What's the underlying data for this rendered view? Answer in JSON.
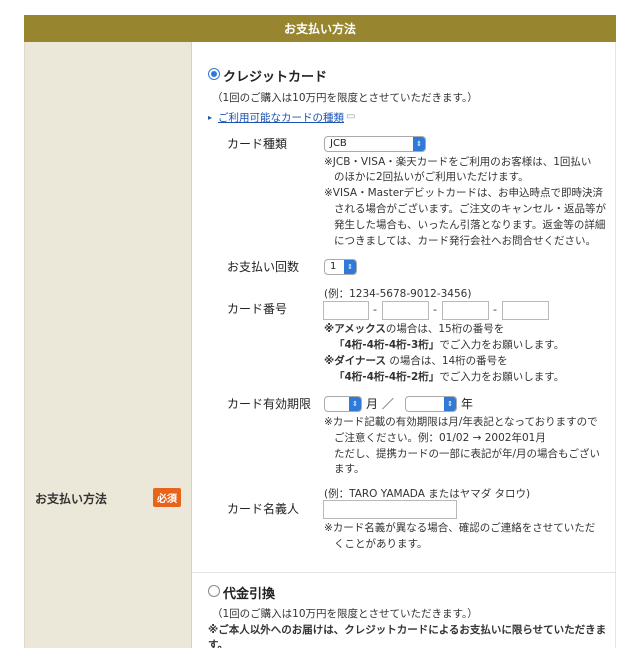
{
  "section": {
    "title": "お支払い方法"
  },
  "left": {
    "label": "お支払い方法",
    "required": "必須"
  },
  "credit": {
    "title": "クレジットカード",
    "limit_note": "（1回のご購入は10万円を限度とさせていただきます。）",
    "cards_link": "ご利用可能なカードの種類",
    "card_type": {
      "label": "カード種類",
      "selected": "JCB",
      "notes": [
        "※JCB・VISA・楽天カードをご利用のお客様は、1回払い",
        "のほかに2回払いがご利用いただけます。",
        "※VISA・Masterデビットカードは、お申込時点で即時決済",
        "される場合がございます。ご注文のキャンセル・返品等が",
        "発生した場合も、いったん引落となります。返金等の詳細",
        "につきましては、カード発行会社へお問合せください。"
      ]
    },
    "installments": {
      "label": "お支払い回数",
      "selected": "1"
    },
    "card_number": {
      "label": "カード番号",
      "example": "(例：1234-5678-9012-3456)",
      "sep": "-",
      "amex_note_prefix": "※アメックス",
      "amex_note_suffix": "の場合は、15桁の番号を",
      "amex_format": "「4桁-4桁-4桁-3桁」",
      "amex_format_suffix": "でご入力をお願いします。",
      "diners_note_prefix": "※ダイナース",
      "diners_note_suffix": " の場合は、14桁の番号を",
      "diners_format": "「4桁-4桁-4桁-2桁」",
      "diners_format_suffix": "でご入力をお願いします。"
    },
    "expiry": {
      "label": "カード有効期限",
      "month_label": "月 ／",
      "year_label": "年",
      "notes": [
        "※カード記載の有効期限は月/年表記となっておりますので",
        "ご注意ください。例：01/02 → 2002年01月",
        "ただし、提携カードの一部に表記が年/月の場合もござい",
        "ます。"
      ]
    },
    "holder": {
      "label": "カード名義人",
      "example": "(例：TARO YAMADA またはヤマダ タロウ)",
      "notes": [
        "※カード名義が異なる場合、確認のご連絡をさせていただ",
        "くことがあります。"
      ]
    }
  },
  "cod": {
    "title": "代金引換",
    "limit_note": "（1回のご購入は10万円を限度とさせていただきます。）",
    "warning": "※ご本人以外へのお届けは、クレジットカードによるお支払いに限らせていただきま",
    "warning_cont": "す。"
  },
  "colors": {
    "header": "#97852f",
    "left_bg": "#ece8d9",
    "accent": "#2f7ad8",
    "badge": "#e8641b"
  }
}
